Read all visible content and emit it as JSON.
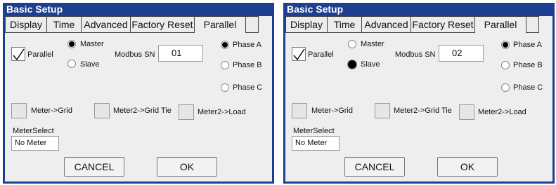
{
  "panels": [
    {
      "title": "Basic Setup",
      "tabs": [
        "Display",
        "Time",
        "Advanced",
        "Factory Reset",
        "Parallel"
      ],
      "active_tab": "Parallel",
      "parallel_label": "Parallel",
      "parallel_checked": true,
      "role_master": "Master",
      "role_slave": "Slave",
      "selected_role": "Master",
      "modbus_label": "Modbus SN",
      "modbus_value": "01",
      "phase_a": "Phase A",
      "phase_b": "Phase B",
      "phase_c": "Phase C",
      "selected_phase": "Phase A",
      "meter_grid": "Meter->Grid",
      "meter2_grid_tie": "Meter2->Grid Tie",
      "meter2_load": "Meter2->Load",
      "meter_select_label": "MeterSelect",
      "meter_select_value": "No Meter",
      "cancel": "CANCEL",
      "ok": "OK"
    },
    {
      "title": "Basic Setup",
      "tabs": [
        "Display",
        "Time",
        "Advanced",
        "Factory Reset",
        "Parallel"
      ],
      "active_tab": "Parallel",
      "parallel_label": "Parallel",
      "parallel_checked": true,
      "role_master": "Master",
      "role_slave": "Slave",
      "selected_role": "Slave",
      "modbus_label": "Modbus SN",
      "modbus_value": "02",
      "phase_a": "Phase A",
      "phase_b": "Phase B",
      "phase_c": "Phase C",
      "selected_phase": "Phase A",
      "meter_grid": "Meter->Grid",
      "meter2_grid_tie": "Meter2->Grid Tie",
      "meter2_load": "Meter2->Load",
      "meter_select_label": "MeterSelect",
      "meter_select_value": "No Meter",
      "cancel": "CANCEL",
      "ok": "OK"
    }
  ],
  "colors": {
    "title_bar": "#1e3f8f",
    "panel_bg": "#eeeeee",
    "radio_dot": "#000000"
  }
}
